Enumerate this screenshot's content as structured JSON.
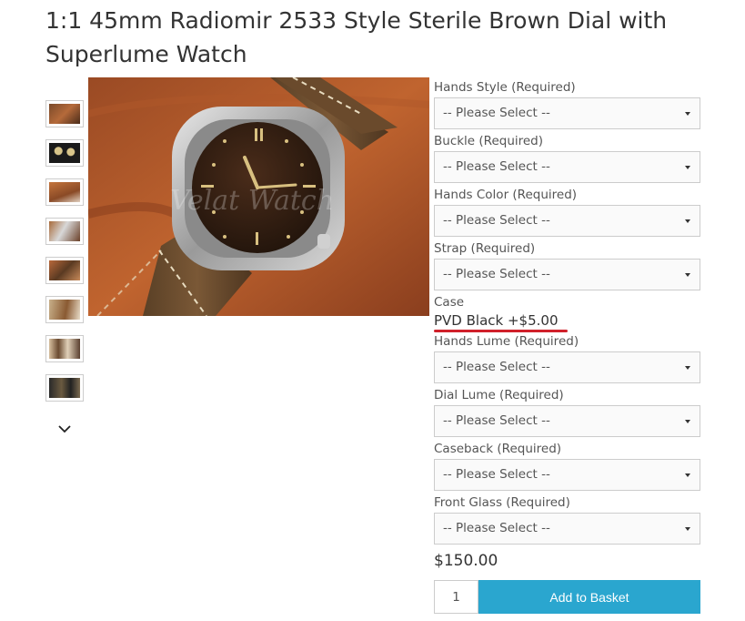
{
  "product": {
    "title": "1:1 45mm Radiomir 2533 Style Sterile Brown Dial with Superlume Watch",
    "watermark": "Velat Watch",
    "price": "$150.00"
  },
  "gallery": {
    "thumbnails": [
      "thumb-1",
      "thumb-2",
      "thumb-3",
      "thumb-4",
      "thumb-5",
      "thumb-6",
      "thumb-7",
      "thumb-8"
    ],
    "more_icon": "chevron-down-icon"
  },
  "options": {
    "hands_style": {
      "label": "Hands Style (Required)",
      "value": "-- Please Select --"
    },
    "buckle": {
      "label": "Buckle (Required)",
      "value": "-- Please Select --"
    },
    "hands_color": {
      "label": "Hands Color (Required)",
      "value": "-- Please Select --"
    },
    "strap": {
      "label": "Strap (Required)",
      "value": "-- Please Select --"
    },
    "case": {
      "label": "Case",
      "value": "PVD Black +$5.00"
    },
    "hands_lume": {
      "label": "Hands Lume (Required)",
      "value": "-- Please Select --"
    },
    "dial_lume": {
      "label": "Dial Lume (Required)",
      "value": "-- Please Select --"
    },
    "caseback": {
      "label": "Caseback (Required)",
      "value": "-- Please Select --"
    },
    "front_glass": {
      "label": "Front Glass (Required)",
      "value": "-- Please Select --"
    }
  },
  "purchase": {
    "quantity": "1",
    "add_label": "Add to Basket"
  },
  "colors": {
    "button": "#2aa6cf",
    "highlight": "#d0202a"
  }
}
